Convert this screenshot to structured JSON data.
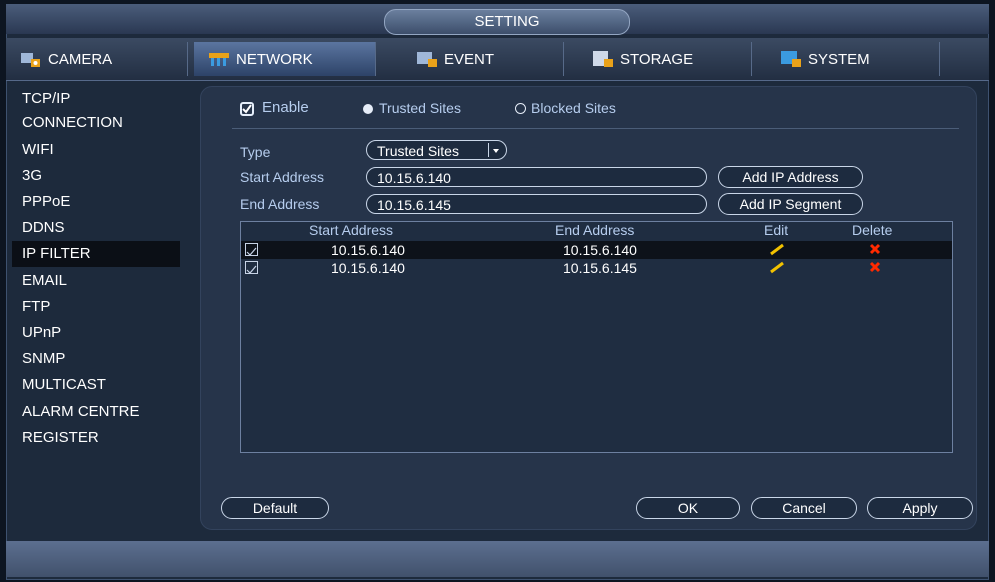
{
  "window": {
    "title": "SETTING"
  },
  "tabs": [
    {
      "label": "CAMERA",
      "icon": "camera-icon"
    },
    {
      "label": "NETWORK",
      "icon": "network-icon"
    },
    {
      "label": "EVENT",
      "icon": "event-icon"
    },
    {
      "label": "STORAGE",
      "icon": "storage-icon"
    },
    {
      "label": "SYSTEM",
      "icon": "system-icon"
    }
  ],
  "sidebar": {
    "items": [
      "TCP/IP",
      "CONNECTION",
      "WIFI",
      "3G",
      "PPPoE",
      "DDNS",
      "IP FILTER",
      "EMAIL",
      "FTP",
      "UPnP",
      "SNMP",
      "MULTICAST",
      "ALARM CENTRE",
      "REGISTER"
    ],
    "active": "IP FILTER"
  },
  "filter": {
    "enable_label": "Enable",
    "enable_checked": true,
    "trusted_label": "Trusted Sites",
    "blocked_label": "Blocked Sites",
    "selected_mode": "Trusted Sites",
    "type_label": "Type",
    "type_value": "Trusted Sites",
    "start_label": "Start Address",
    "start_value": "10.15.6.140",
    "end_label": "End Address",
    "end_value": "10.15.6.145",
    "add_ip_label": "Add IP Address",
    "add_segment_label": "Add IP Segment"
  },
  "table": {
    "headers": {
      "start": "Start Address",
      "end": "End Address",
      "edit": "Edit",
      "delete": "Delete"
    },
    "rows": [
      {
        "checked": true,
        "start": "10.15.6.140",
        "end": "10.15.6.140"
      },
      {
        "checked": true,
        "start": "10.15.6.140",
        "end": "10.15.6.145"
      }
    ]
  },
  "buttons": {
    "default": "Default",
    "ok": "OK",
    "cancel": "Cancel",
    "apply": "Apply"
  },
  "colors": {
    "edit_icon": "#f2c200",
    "delete_icon": "#ff2a00",
    "accent": "#b6cdee"
  }
}
